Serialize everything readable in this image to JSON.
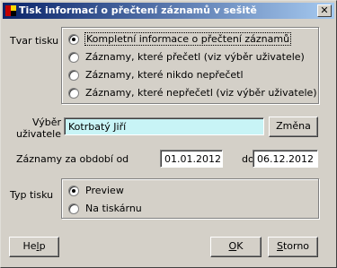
{
  "window": {
    "title": "Tisk informací o přečtení záznamů v sešitě",
    "close_glyph": "✕"
  },
  "print_type": {
    "label": "Tvar tisku",
    "options": [
      {
        "label": "Kompletní informace o přečtení záznamů",
        "selected": true
      },
      {
        "label": "Záznamy, které přečetl (viz výběr uživatele)",
        "selected": false
      },
      {
        "label": "Záznamy, které nikdo nepřečetl",
        "selected": false
      },
      {
        "label": "Záznamy, které nepřečetl (viz výběr uživatele)",
        "selected": false
      }
    ]
  },
  "user_select": {
    "label_line1": "Výběr",
    "label_line2": "uživatele",
    "value": "Kotrbatý Jiří",
    "change_button": "Změna"
  },
  "period": {
    "label": "Záznamy za období od",
    "from": "01.01.2012",
    "to_label": "do",
    "to": "06.12.2012"
  },
  "output_type": {
    "label": "Typ tisku",
    "options": [
      {
        "label": "Preview",
        "selected": true
      },
      {
        "label": "Na tiskárnu",
        "selected": false
      }
    ]
  },
  "buttons": {
    "help_prefix": "He",
    "help_mnemonic": "l",
    "help_suffix": "p",
    "ok_mnemonic": "O",
    "ok_suffix": "K",
    "storno_mnemonic": "S",
    "storno_suffix": "torno"
  },
  "colors": {
    "titlebar_start": "#0a246a",
    "titlebar_end": "#a6caf0",
    "dialog_bg": "#d4d0c8",
    "user_field_bg": "#c8f4f6"
  }
}
